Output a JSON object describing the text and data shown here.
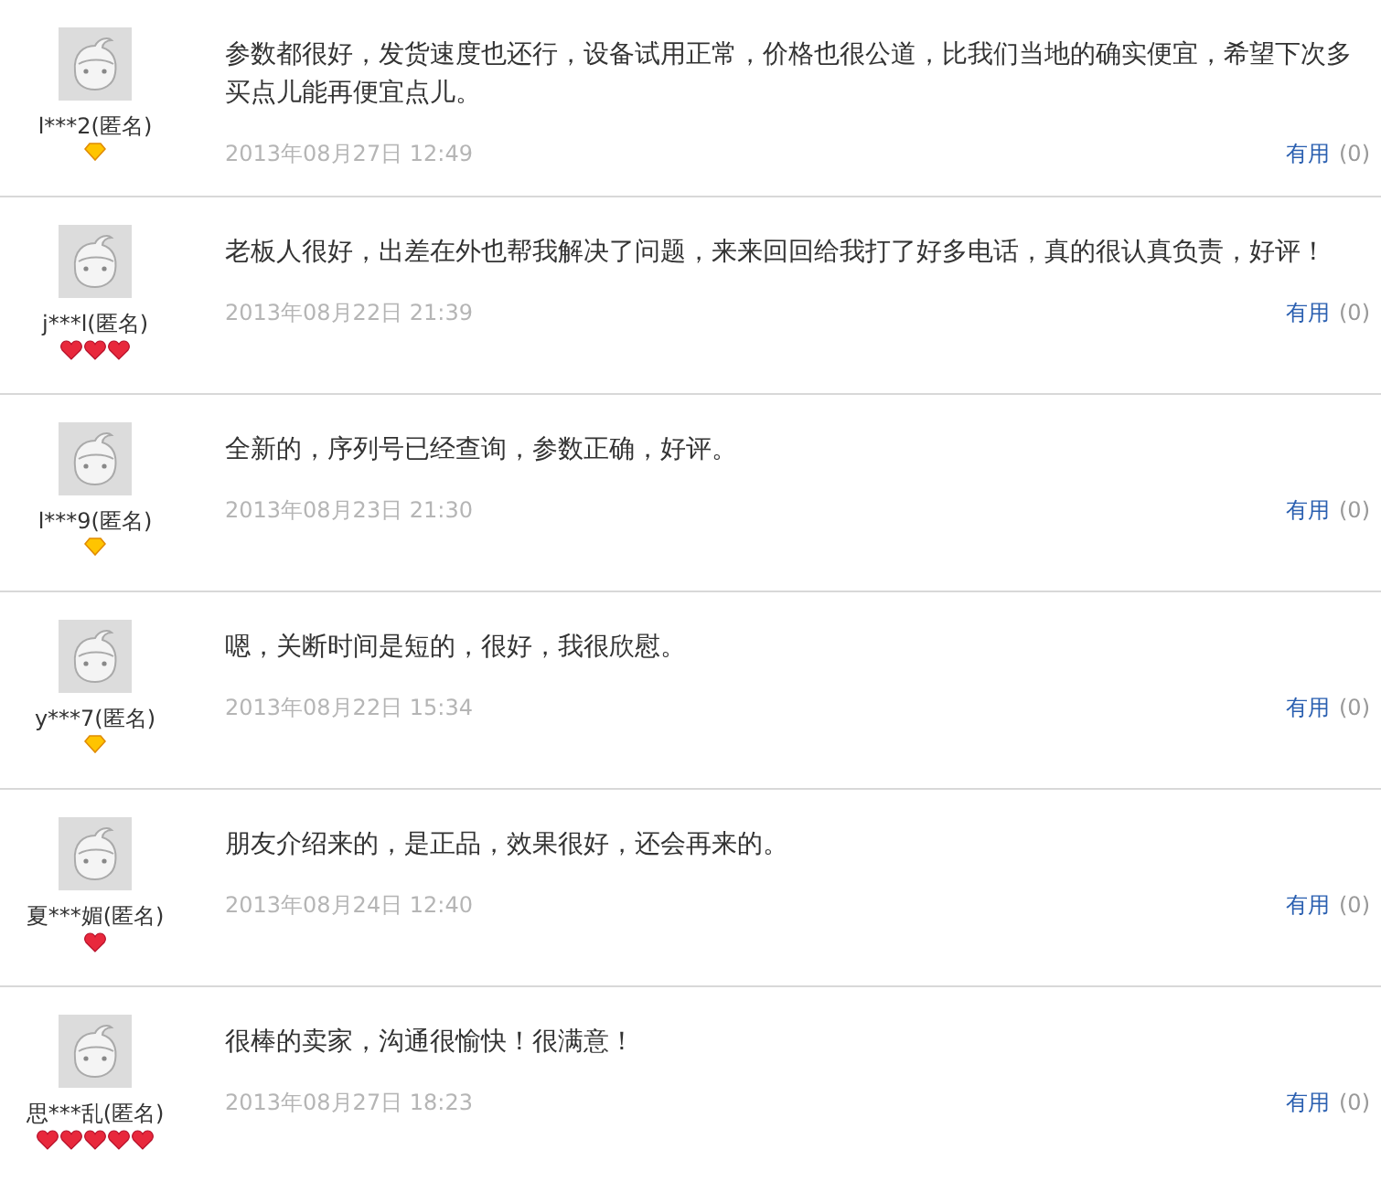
{
  "reviews": [
    {
      "user": "l***2(匿名)",
      "badges": [
        {
          "kind": "diamond"
        }
      ],
      "text": "参数都很好，发货速度也还行，设备试用正常，价格也很公道，比我们当地的确实便宜，希望下次多买点儿能再便宜点儿。",
      "date": "2013年08月27日 12:49",
      "useful": "有用",
      "useful_count": "(0)"
    },
    {
      "user": "j***l(匿名)",
      "badges": [
        {
          "kind": "heart"
        },
        {
          "kind": "heart"
        },
        {
          "kind": "heart"
        }
      ],
      "text": "老板人很好，出差在外也帮我解决了问题，来来回回给我打了好多电话，真的很认真负责，好评！",
      "date": "2013年08月22日 21:39",
      "useful": "有用",
      "useful_count": "(0)"
    },
    {
      "user": "l***9(匿名)",
      "badges": [
        {
          "kind": "diamond"
        }
      ],
      "text": "全新的，序列号已经查询，参数正确，好评。",
      "date": "2013年08月23日 21:30",
      "useful": "有用",
      "useful_count": "(0)"
    },
    {
      "user": "y***7(匿名)",
      "badges": [
        {
          "kind": "diamond"
        }
      ],
      "text": "嗯，关断时间是短的，很好，我很欣慰。",
      "date": "2013年08月22日 15:34",
      "useful": "有用",
      "useful_count": "(0)"
    },
    {
      "user": "夏***媚(匿名)",
      "badges": [
        {
          "kind": "heart"
        }
      ],
      "text": "朋友介绍来的，是正品，效果很好，还会再来的。",
      "date": "2013年08月24日 12:40",
      "useful": "有用",
      "useful_count": "(0)"
    },
    {
      "user": "思***乱(匿名)",
      "badges": [
        {
          "kind": "heart"
        },
        {
          "kind": "heart"
        },
        {
          "kind": "heart"
        },
        {
          "kind": "heart"
        },
        {
          "kind": "heart"
        }
      ],
      "text": "很棒的卖家，沟通很愉快！很满意！",
      "date": "2013年08月27日 18:23",
      "useful": "有用",
      "useful_count": "(0)"
    }
  ]
}
